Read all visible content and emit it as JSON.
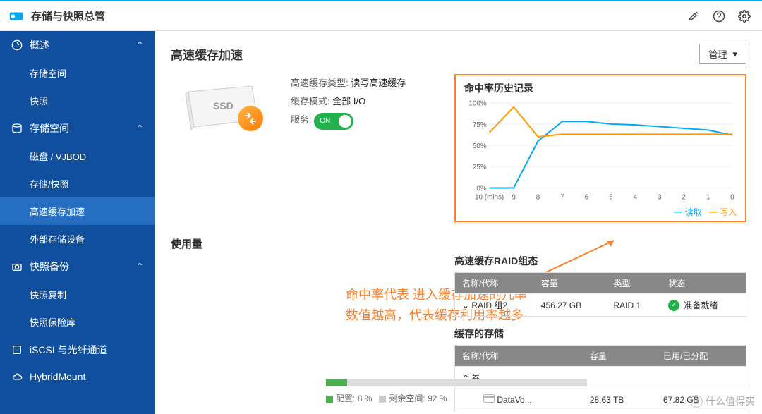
{
  "titlebar": {
    "app": "存储与快照总管"
  },
  "sidebar": {
    "overview": {
      "label": "概述",
      "sub1": "存储空间",
      "sub2": "快照"
    },
    "storage": {
      "label": "存储空间",
      "sub1": "磁盘 / VJBOD",
      "sub2": "存储/快照",
      "sub3": "高速缓存加速",
      "sub4": "外部存储设备"
    },
    "backup": {
      "label": "快照备份",
      "sub1": "快照复制",
      "sub2": "快照保险库"
    },
    "iscsi": "iSCSI 与光纤通道",
    "hybrid": "HybridMount"
  },
  "main": {
    "title": "高速缓存加速",
    "manage": "管理",
    "cache_type_label": "高速缓存类型:",
    "cache_type": "读写高速缓存",
    "cache_mode_label": "缓存模式:",
    "cache_mode": "全部 I/O",
    "service_label": "服务:",
    "service_on": "ON",
    "usage_title": "使用量"
  },
  "chart": {
    "title": "命中率历史记录",
    "legend_read": "读取",
    "legend_write": "写入",
    "xaxis_label": "10 (mins)"
  },
  "chart_data": {
    "type": "line",
    "title": "命中率历史记录",
    "ylabel": "%",
    "ylim": [
      0,
      100
    ],
    "x": [
      10,
      9,
      8,
      7,
      6,
      5,
      4,
      3,
      2,
      1,
      0
    ],
    "x_ticks": [
      "10 (mins)",
      "9",
      "8",
      "7",
      "6",
      "5",
      "4",
      "3",
      "2",
      "1",
      "0"
    ],
    "y_ticks": [
      0,
      25,
      50,
      75,
      100
    ],
    "series": [
      {
        "name": "读取",
        "color": "#03a9f4",
        "values": [
          0,
          0,
          55,
          78,
          78,
          75,
          74,
          72,
          70,
          68,
          62
        ]
      },
      {
        "name": "写入",
        "color": "#ff9800",
        "values": [
          65,
          95,
          60,
          63,
          63,
          63,
          63,
          63,
          63,
          63,
          63
        ]
      }
    ]
  },
  "annotation": {
    "line1": "命中率代表 进入缓存加速的几率",
    "line2": "数值越高，代表缓存利用率越多"
  },
  "raid": {
    "title": "高速缓存RAID组态",
    "h1": "名称/代称",
    "h2": "容量",
    "h3": "类型",
    "h4": "状态",
    "r1c1": "RAID 组2",
    "r1c2": "456.27 GB",
    "r1c3": "RAID 1",
    "r1c4": "准备就绪"
  },
  "cached": {
    "title": "缓存的存储",
    "h1": "名称/代称",
    "h2": "容量",
    "h3": "已用/已分配",
    "r1": "卷",
    "r2c1": "DataVo...",
    "r2c2": "28.63 TB",
    "r2c3": "67.82 GB"
  },
  "usage_bar": {
    "used_label": "配置:",
    "used_pct": "8 %",
    "free_label": "剩余空间:",
    "free_pct": "92 %",
    "used_width": 8
  },
  "watermark": "什么值得买"
}
